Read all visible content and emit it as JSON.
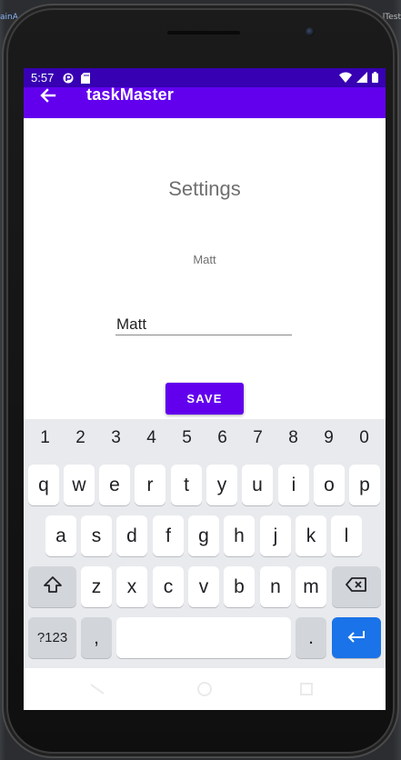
{
  "ide": {
    "tab_left": "ainA",
    "tab_right": "lTest"
  },
  "status_bar": {
    "time": "5:57",
    "icons": [
      "notification-icon",
      "sd-card-icon",
      "wifi-icon",
      "signal-icon",
      "battery-icon"
    ]
  },
  "app_bar": {
    "title": "taskMaster",
    "back_icon": "arrow-back-icon"
  },
  "settings": {
    "title": "Settings",
    "username_display": "Matt",
    "name_input_value": "Matt",
    "save_label": "SAVE"
  },
  "keyboard": {
    "number_row": [
      "1",
      "2",
      "3",
      "4",
      "5",
      "6",
      "7",
      "8",
      "9",
      "0"
    ],
    "row1": [
      "q",
      "w",
      "e",
      "r",
      "t",
      "y",
      "u",
      "i",
      "o",
      "p"
    ],
    "row2": [
      "a",
      "s",
      "d",
      "f",
      "g",
      "h",
      "j",
      "k",
      "l"
    ],
    "row3": [
      "z",
      "x",
      "c",
      "v",
      "b",
      "n",
      "m"
    ],
    "symbols_label": "?123",
    "comma": ",",
    "period": ".",
    "shift_icon": "shift-icon",
    "backspace_icon": "backspace-icon",
    "enter_icon": "enter-icon"
  },
  "colors": {
    "primary": "#6200ee",
    "primary_dark": "#3700b3",
    "enter_key": "#1a73e8"
  }
}
